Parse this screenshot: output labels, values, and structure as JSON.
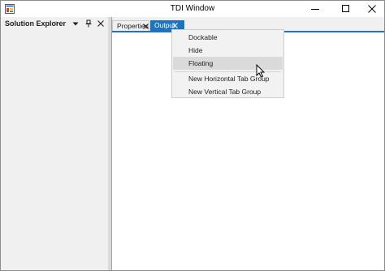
{
  "window": {
    "title": "TDI Window",
    "icon": "app-icon",
    "controls": [
      "minimize-icon",
      "maximize-icon",
      "close-icon"
    ]
  },
  "solution_explorer": {
    "title": "Solution Explorer",
    "icons": [
      "grip-icon",
      "dropdown-arrow-icon",
      "pin-icon",
      "close-icon"
    ]
  },
  "document_tabs": [
    {
      "label": "Properties",
      "active": false
    },
    {
      "label": "Output",
      "active": true
    }
  ],
  "context_menu": {
    "items": [
      {
        "label": "Dockable"
      },
      {
        "label": "Hide"
      },
      {
        "label": "Floating",
        "hovered": true
      },
      {
        "label": "New Horizontal Tab Group"
      },
      {
        "label": "New Vertical Tab Group"
      }
    ]
  },
  "colors": {
    "accent": "#1e73be",
    "panel_bg": "#f0f0f0",
    "menu_bg": "#f2f2f2",
    "menu_hover": "#dadada"
  }
}
